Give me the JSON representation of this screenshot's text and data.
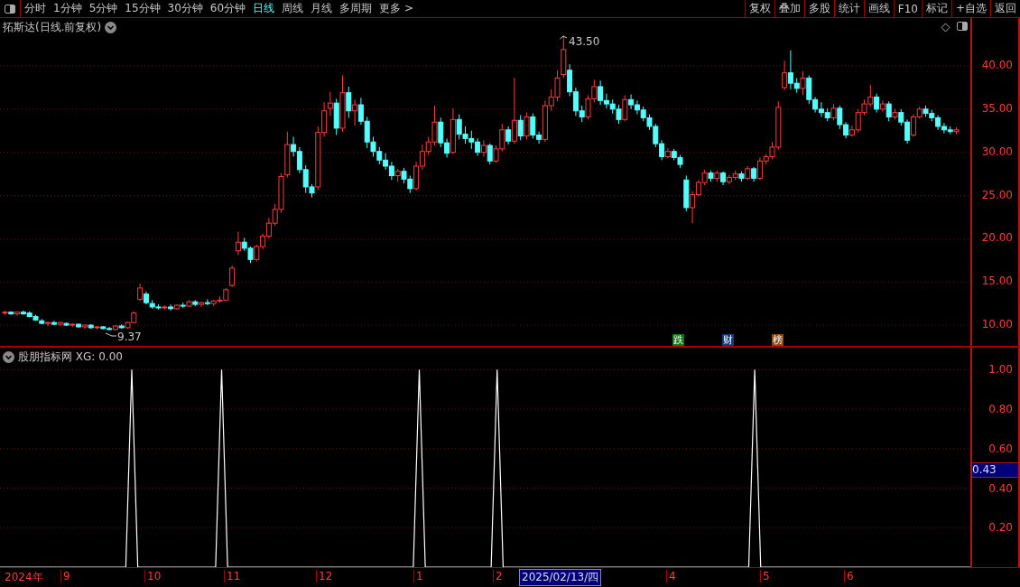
{
  "toolbar": {
    "periods": [
      {
        "label": "分时",
        "selected": false
      },
      {
        "label": "1分钟",
        "selected": false
      },
      {
        "label": "5分钟",
        "selected": false
      },
      {
        "label": "15分钟",
        "selected": false
      },
      {
        "label": "30分钟",
        "selected": false
      },
      {
        "label": "60分钟",
        "selected": false
      },
      {
        "label": "日线",
        "selected": true
      },
      {
        "label": "周线",
        "selected": false
      },
      {
        "label": "月线",
        "selected": false
      },
      {
        "label": "多周期",
        "selected": false
      },
      {
        "label": "更多 >",
        "selected": false
      }
    ],
    "actions": [
      "复权",
      "叠加",
      "多股",
      "统计",
      "画线",
      "F10",
      "标记",
      "+自选",
      "返回"
    ]
  },
  "main_chart": {
    "title": "拓斯达(日线.前复权)",
    "high_label": "43.50",
    "low_label": "9.37",
    "chart_data": {
      "type": "candlestick",
      "ylim": [
        7.6,
        45.54
      ],
      "grid": true,
      "yticks": [
        {
          "value": 40,
          "label": "40.00"
        },
        {
          "value": 35,
          "label": "35.00"
        },
        {
          "value": 30,
          "label": "30.00"
        },
        {
          "value": 25,
          "label": "25.00"
        },
        {
          "value": 20,
          "label": "20.00"
        },
        {
          "value": 15,
          "label": "15.00"
        },
        {
          "value": 10,
          "label": "10.00"
        }
      ],
      "ohlc": [
        [
          11.4,
          11.7,
          11.2,
          11.5
        ],
        [
          11.5,
          11.6,
          11.2,
          11.3
        ],
        [
          11.3,
          11.6,
          11.1,
          11.5
        ],
        [
          11.5,
          11.7,
          11.2,
          11.3
        ],
        [
          11.4,
          11.6,
          10.9,
          11.0
        ],
        [
          11.0,
          11.2,
          10.5,
          10.6
        ],
        [
          10.5,
          10.7,
          10.1,
          10.2
        ],
        [
          10.2,
          10.4,
          9.9,
          10.3
        ],
        [
          10.3,
          10.5,
          10.0,
          10.1
        ],
        [
          10.1,
          10.4,
          9.9,
          10.3
        ],
        [
          10.2,
          10.3,
          9.9,
          10.0
        ],
        [
          10.0,
          10.2,
          9.8,
          10.1
        ],
        [
          10.1,
          10.2,
          9.7,
          9.8
        ],
        [
          9.8,
          10.1,
          9.6,
          10.0
        ],
        [
          10.0,
          10.1,
          9.6,
          9.7
        ],
        [
          9.7,
          9.9,
          9.5,
          9.8
        ],
        [
          9.8,
          9.9,
          9.5,
          9.6
        ],
        [
          9.6,
          9.8,
          9.37,
          9.5
        ],
        [
          9.5,
          10.0,
          9.4,
          9.9
        ],
        [
          9.9,
          10.1,
          9.6,
          9.7
        ],
        [
          9.7,
          10.4,
          9.6,
          10.3
        ],
        [
          10.3,
          11.6,
          10.2,
          11.4
        ],
        [
          13.0,
          14.8,
          12.8,
          14.3
        ],
        [
          13.6,
          13.9,
          12.4,
          12.6
        ],
        [
          12.5,
          12.9,
          11.9,
          12.1
        ],
        [
          12.1,
          12.4,
          11.8,
          12.0
        ],
        [
          12.0,
          12.3,
          11.8,
          12.1
        ],
        [
          12.1,
          12.4,
          11.7,
          11.9
        ],
        [
          11.9,
          12.4,
          11.8,
          12.3
        ],
        [
          12.3,
          12.6,
          12.0,
          12.2
        ],
        [
          12.2,
          12.9,
          12.1,
          12.7
        ],
        [
          12.7,
          12.9,
          12.2,
          12.4
        ],
        [
          12.4,
          12.7,
          12.1,
          12.6
        ],
        [
          12.6,
          13.0,
          12.3,
          12.5
        ],
        [
          12.5,
          12.9,
          12.2,
          12.8
        ],
        [
          12.8,
          13.3,
          12.6,
          12.9
        ],
        [
          12.9,
          14.3,
          12.8,
          14.1
        ],
        [
          14.6,
          16.9,
          14.4,
          16.6
        ],
        [
          18.6,
          20.8,
          18.1,
          19.6
        ],
        [
          19.6,
          20.1,
          18.6,
          18.9
        ],
        [
          18.9,
          19.1,
          17.2,
          17.6
        ],
        [
          17.6,
          19.3,
          17.4,
          19.1
        ],
        [
          19.1,
          20.6,
          18.8,
          20.3
        ],
        [
          20.3,
          22.4,
          20.0,
          21.8
        ],
        [
          21.8,
          24.0,
          21.5,
          23.4
        ],
        [
          23.4,
          27.6,
          23.0,
          27.2
        ],
        [
          27.4,
          32.4,
          27.1,
          30.9
        ],
        [
          30.9,
          31.8,
          29.5,
          30.1
        ],
        [
          30.1,
          30.6,
          27.6,
          28.0
        ],
        [
          28.0,
          28.5,
          25.3,
          26.0
        ],
        [
          26.0,
          26.3,
          24.8,
          25.3
        ],
        [
          26.0,
          33.0,
          25.6,
          32.3
        ],
        [
          32.3,
          35.8,
          31.8,
          34.8
        ],
        [
          35.1,
          37.0,
          34.2,
          35.7
        ],
        [
          35.7,
          36.2,
          32.0,
          32.8
        ],
        [
          32.8,
          38.9,
          32.4,
          36.9
        ],
        [
          36.9,
          37.6,
          34.0,
          34.8
        ],
        [
          34.8,
          36.1,
          33.1,
          35.5
        ],
        [
          35.5,
          36.3,
          33.2,
          33.6
        ],
        [
          33.6,
          34.1,
          30.5,
          31.2
        ],
        [
          31.2,
          31.8,
          29.5,
          30.1
        ],
        [
          30.1,
          30.6,
          28.6,
          29.1
        ],
        [
          29.1,
          29.9,
          28.0,
          28.4
        ],
        [
          28.4,
          28.9,
          26.8,
          27.3
        ],
        [
          27.3,
          28.1,
          26.6,
          27.8
        ],
        [
          27.8,
          28.2,
          26.4,
          26.9
        ],
        [
          26.9,
          27.3,
          25.3,
          25.8
        ],
        [
          25.8,
          28.9,
          25.6,
          28.4
        ],
        [
          28.4,
          30.9,
          28.0,
          30.1
        ],
        [
          30.1,
          31.8,
          29.7,
          31.2
        ],
        [
          31.2,
          35.4,
          30.8,
          33.5
        ],
        [
          33.5,
          34.0,
          30.6,
          31.1
        ],
        [
          31.1,
          31.6,
          29.4,
          29.9
        ],
        [
          30.0,
          35.1,
          29.8,
          33.8
        ],
        [
          33.8,
          34.4,
          31.5,
          32.1
        ],
        [
          32.1,
          33.0,
          31.0,
          31.6
        ],
        [
          31.6,
          32.5,
          30.4,
          31.2
        ],
        [
          31.2,
          31.6,
          29.6,
          30.0
        ],
        [
          30.0,
          31.4,
          29.5,
          30.8
        ],
        [
          30.8,
          31.0,
          28.6,
          29.0
        ],
        [
          29.0,
          30.8,
          28.8,
          30.4
        ],
        [
          30.4,
          33.3,
          30.1,
          32.6
        ],
        [
          32.6,
          33.0,
          30.9,
          31.3
        ],
        [
          31.3,
          38.6,
          31.0,
          33.7
        ],
        [
          33.7,
          34.3,
          31.4,
          31.9
        ],
        [
          31.9,
          34.6,
          31.5,
          34.1
        ],
        [
          34.1,
          34.5,
          31.6,
          32.0
        ],
        [
          32.0,
          32.4,
          31.0,
          31.5
        ],
        [
          31.5,
          36.0,
          31.2,
          35.4
        ],
        [
          35.4,
          37.3,
          34.8,
          36.4
        ],
        [
          36.4,
          39.5,
          35.9,
          38.6
        ],
        [
          39.0,
          43.5,
          38.6,
          41.9
        ],
        [
          39.5,
          40.2,
          36.5,
          37.0
        ],
        [
          37.0,
          37.5,
          34.2,
          34.8
        ],
        [
          34.8,
          35.4,
          33.5,
          34.1
        ],
        [
          34.1,
          36.6,
          33.8,
          36.2
        ],
        [
          36.2,
          38.4,
          35.8,
          37.6
        ],
        [
          37.6,
          38.3,
          35.5,
          36.0
        ],
        [
          36.0,
          36.8,
          35.1,
          35.6
        ],
        [
          35.6,
          36.1,
          34.5,
          35.0
        ],
        [
          35.0,
          35.5,
          33.3,
          33.8
        ],
        [
          33.8,
          36.6,
          33.6,
          36.1
        ],
        [
          36.1,
          36.7,
          35.0,
          35.5
        ],
        [
          35.5,
          36.0,
          34.4,
          34.9
        ],
        [
          34.9,
          35.3,
          33.6,
          34.0
        ],
        [
          34.0,
          34.4,
          32.6,
          33.0
        ],
        [
          33.0,
          33.3,
          30.6,
          31.0
        ],
        [
          31.0,
          31.4,
          29.1,
          29.5
        ],
        [
          29.5,
          30.5,
          29.3,
          30.1
        ],
        [
          30.1,
          30.4,
          29.1,
          29.4
        ],
        [
          29.4,
          29.7,
          28.2,
          28.6
        ],
        [
          26.8,
          27.3,
          23.2,
          23.6
        ],
        [
          23.6,
          25.5,
          21.8,
          25.1
        ],
        [
          25.1,
          26.8,
          24.9,
          26.5
        ],
        [
          26.5,
          28.0,
          26.2,
          27.6
        ],
        [
          27.6,
          27.9,
          26.6,
          27.0
        ],
        [
          27.0,
          27.9,
          26.6,
          27.6
        ],
        [
          27.6,
          27.8,
          26.2,
          26.6
        ],
        [
          26.6,
          27.4,
          26.3,
          27.1
        ],
        [
          27.1,
          27.9,
          26.8,
          27.5
        ],
        [
          27.5,
          27.8,
          26.6,
          27.0
        ],
        [
          27.0,
          28.4,
          26.8,
          28.1
        ],
        [
          28.1,
          28.3,
          26.6,
          27.0
        ],
        [
          27.0,
          29.4,
          26.8,
          29.0
        ],
        [
          29.0,
          29.8,
          28.6,
          29.5
        ],
        [
          29.5,
          31.2,
          29.2,
          30.6
        ],
        [
          30.6,
          35.9,
          30.3,
          35.2
        ],
        [
          37.5,
          40.6,
          37.2,
          39.2
        ],
        [
          39.2,
          41.8,
          37.3,
          38.0
        ],
        [
          38.0,
          38.6,
          36.9,
          37.4
        ],
        [
          37.4,
          39.4,
          36.6,
          38.6
        ],
        [
          38.6,
          38.9,
          35.6,
          36.1
        ],
        [
          36.1,
          36.4,
          34.6,
          35.0
        ],
        [
          35.0,
          35.8,
          34.1,
          34.6
        ],
        [
          34.6,
          35.1,
          33.6,
          34.0
        ],
        [
          34.0,
          35.6,
          33.7,
          35.1
        ],
        [
          35.1,
          35.4,
          32.7,
          33.2
        ],
        [
          33.2,
          33.5,
          31.6,
          32.0
        ],
        [
          32.0,
          33.1,
          31.8,
          32.6
        ],
        [
          32.6,
          35.0,
          32.3,
          34.6
        ],
        [
          34.6,
          36.1,
          34.3,
          35.6
        ],
        [
          35.6,
          37.8,
          35.3,
          36.4
        ],
        [
          36.4,
          36.8,
          34.6,
          35.0
        ],
        [
          35.0,
          36.0,
          34.7,
          35.6
        ],
        [
          35.6,
          35.9,
          33.6,
          34.1
        ],
        [
          34.1,
          35.0,
          33.8,
          34.6
        ],
        [
          34.6,
          35.0,
          33.1,
          33.5
        ],
        [
          33.5,
          33.8,
          31.0,
          31.4
        ],
        [
          32.0,
          34.4,
          31.8,
          34.1
        ],
        [
          34.1,
          35.3,
          33.9,
          35.0
        ],
        [
          35.0,
          35.4,
          34.1,
          34.5
        ],
        [
          34.5,
          34.9,
          33.6,
          34.0
        ],
        [
          34.0,
          34.3,
          32.6,
          33.0
        ],
        [
          33.0,
          33.4,
          32.2,
          32.6
        ],
        [
          32.6,
          33.0,
          32.1,
          32.4
        ],
        [
          32.4,
          32.9,
          32.1,
          32.6
        ]
      ]
    },
    "markers": [
      {
        "label": "跌",
        "color": "#0f7a12"
      },
      {
        "label": "财",
        "color": "#123c78"
      },
      {
        "label": "榜",
        "color": "#8a4a12"
      }
    ]
  },
  "indicator": {
    "title": "股朋指标网 XG: 0.00",
    "cursor_value": "0.43",
    "chart_data": {
      "type": "line",
      "ylim": [
        0,
        1.111
      ],
      "grid": true,
      "yticks": [
        {
          "value": 1,
          "label": "1.00"
        },
        {
          "value": 0.8,
          "label": "0.80"
        },
        {
          "value": 0.6,
          "label": "0.60"
        },
        {
          "value": 0.4,
          "label": "0.40"
        },
        {
          "value": 0.2,
          "label": "0.20"
        }
      ],
      "values": [
        0,
        0,
        0,
        0,
        0,
        0,
        0,
        0,
        0,
        0,
        0,
        0,
        0,
        0,
        0,
        0,
        0,
        0,
        0,
        0,
        0,
        0,
        1,
        0,
        0,
        0,
        0,
        0,
        0,
        0,
        0,
        0,
        0,
        0,
        0,
        0,
        0,
        1,
        0,
        0,
        0,
        0,
        0,
        0,
        0,
        0,
        0,
        0,
        0,
        0,
        0,
        0,
        0,
        0,
        0,
        0,
        0,
        0,
        0,
        0,
        0,
        0,
        0,
        0,
        0,
        0,
        0,
        0,
        0,
        0,
        1,
        0,
        0,
        0,
        0,
        0,
        0,
        0,
        0,
        0,
        0,
        0,
        0,
        1,
        0,
        0,
        0,
        0,
        0,
        0,
        0,
        0,
        0,
        0,
        0,
        0,
        0,
        0,
        0,
        0,
        0,
        0,
        0,
        0,
        0,
        0,
        0,
        0,
        0,
        0,
        0,
        0,
        0,
        0,
        0,
        0,
        0,
        0,
        0,
        0,
        0,
        0,
        0,
        0,
        0,
        0,
        1,
        0,
        0,
        0,
        0,
        0,
        0,
        0,
        0,
        0,
        0,
        0,
        0,
        0,
        0,
        0,
        0,
        0,
        0,
        0,
        0,
        0,
        0,
        0,
        0,
        0,
        0,
        0,
        0,
        0,
        0,
        0,
        0,
        0,
        0,
        0,
        0
      ]
    }
  },
  "timeline": {
    "year": "2024年",
    "months": [
      "9",
      "10",
      "11",
      "12",
      "1",
      "2",
      "4",
      "5",
      "6"
    ],
    "cursor_date": "2025/02/13/四"
  }
}
